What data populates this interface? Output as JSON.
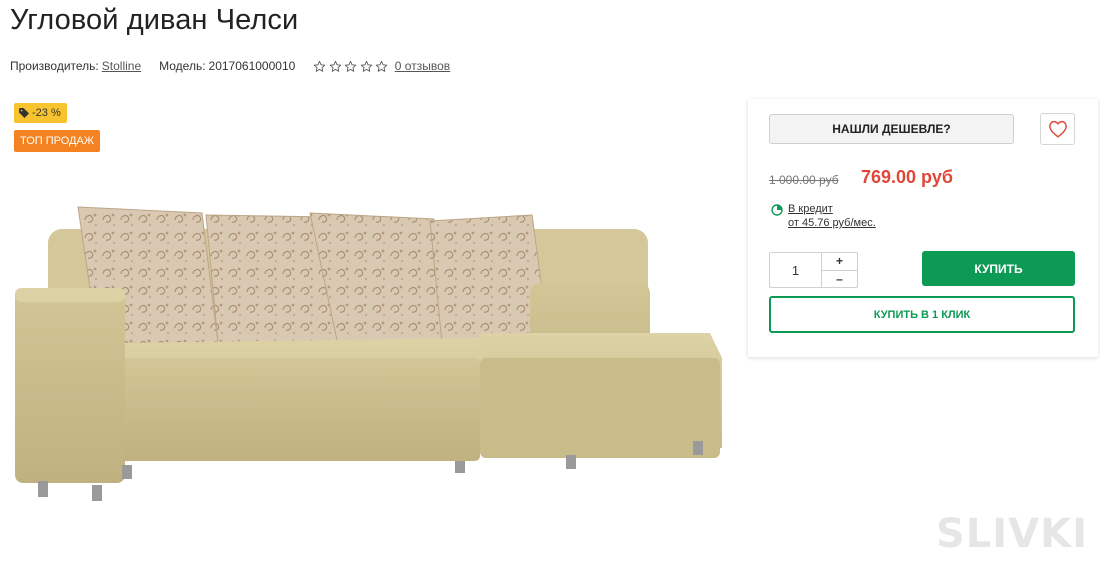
{
  "product": {
    "title": "Угловой диван Челси",
    "manufacturer_label": "Производитель:",
    "manufacturer": "Stolline",
    "model_label": "Модель:",
    "model": "2017061000010",
    "rating": 0,
    "reviews_link": "0 отзывов"
  },
  "badges": {
    "discount": "-23 %",
    "top": "ТОП ПРОДАЖ"
  },
  "buybox": {
    "cheaper_label": "НАШЛИ ДЕШЕВЛЕ?",
    "old_price": "1 000.00 руб",
    "price": "769.00 руб",
    "credit_line1": "В кредит",
    "credit_line2": "от 45.76 руб/мес.",
    "quantity": "1",
    "plus": "+",
    "minus": "–",
    "buy_label": "КУПИТЬ",
    "one_click_label": "КУПИТЬ В 1 КЛИК"
  },
  "icons": {
    "favorite": "heart-icon",
    "credit": "pie-chart-icon",
    "tag": "tag-icon",
    "star": "star-outline-icon"
  },
  "colors": {
    "price": "#e0473b",
    "accent_green": "#0d9a55",
    "badge_sale": "#f7c32e",
    "badge_top": "#f58220",
    "heart": "#e0473b"
  },
  "watermark": "SLIVKI"
}
